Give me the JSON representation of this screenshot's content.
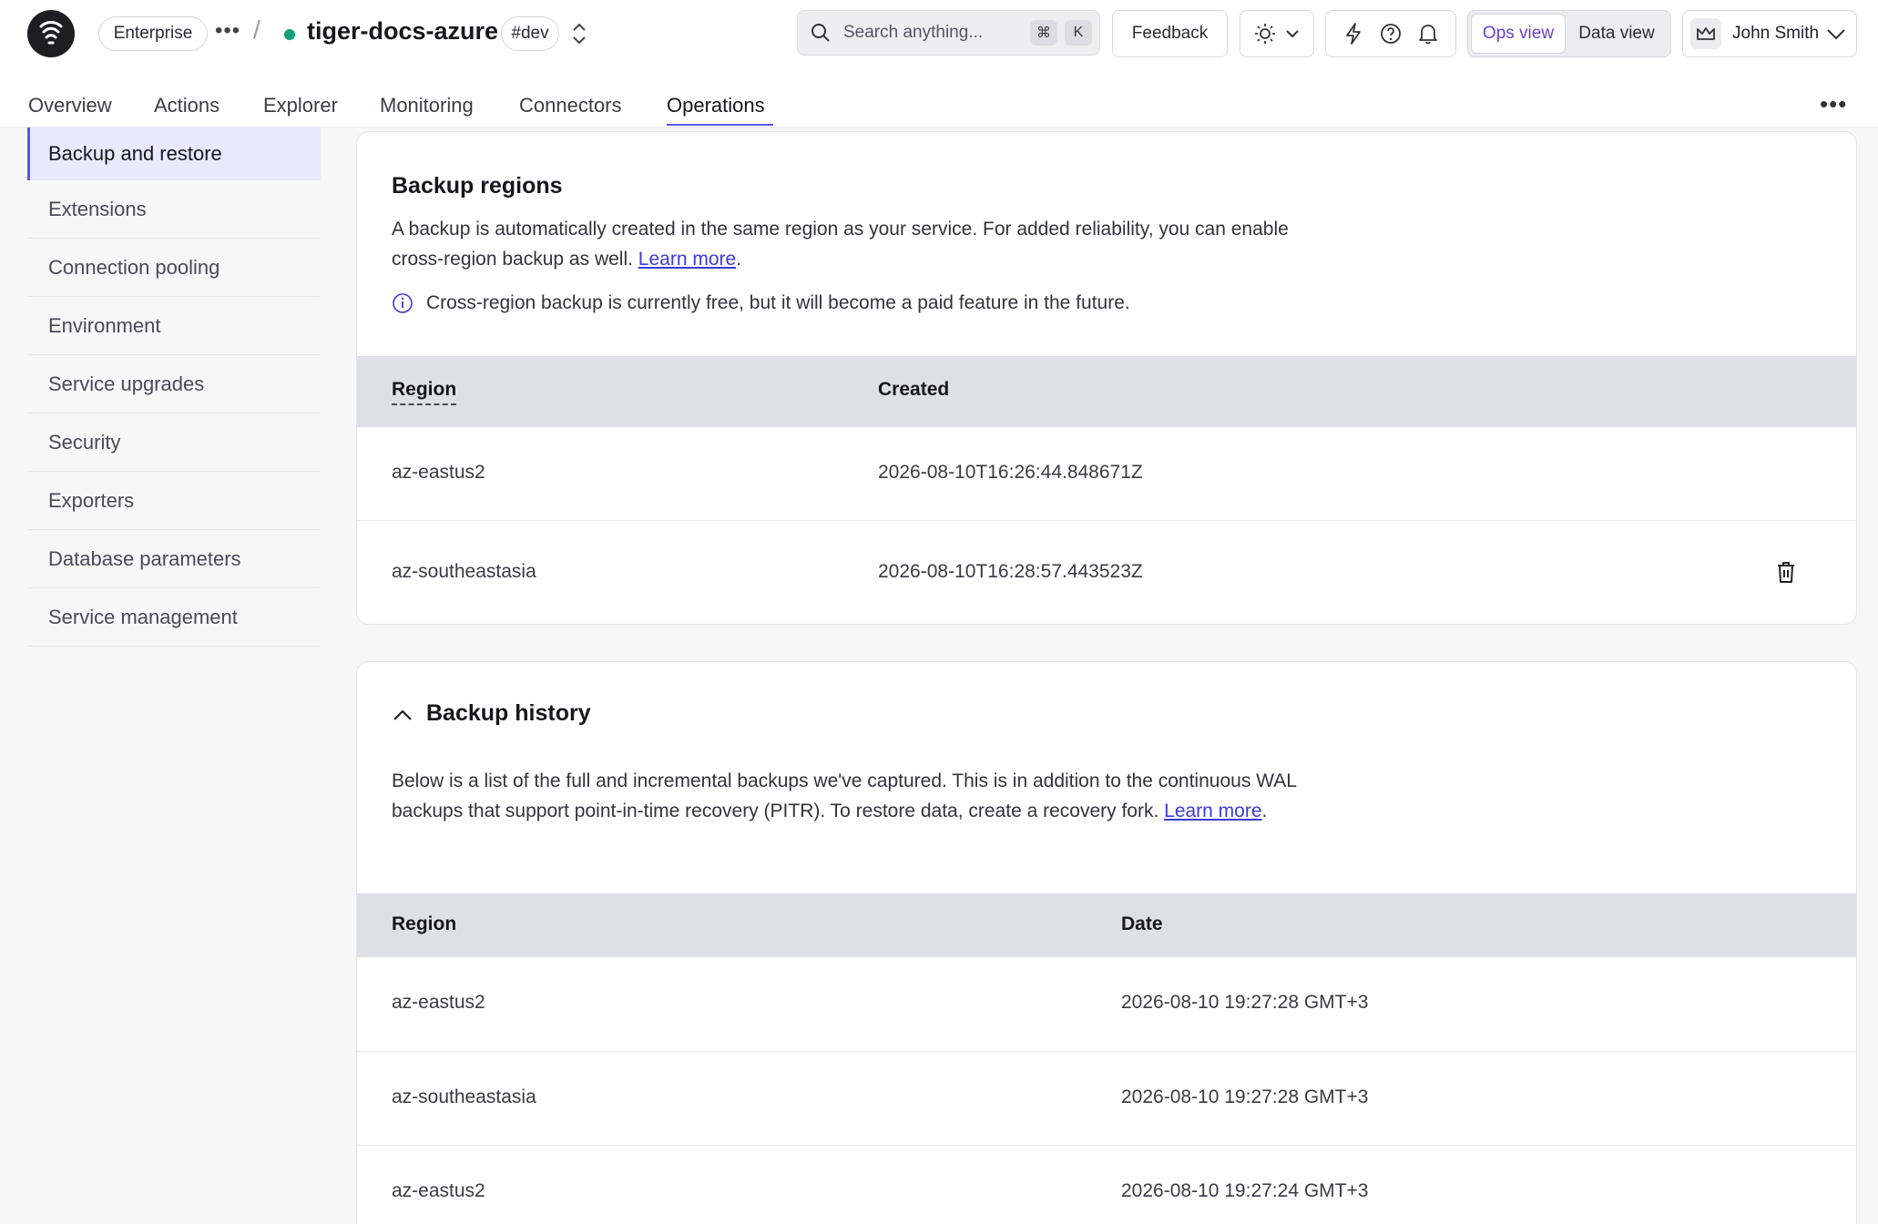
{
  "header": {
    "org_badge": "Enterprise",
    "service_name": "tiger-docs-azure",
    "env_badge": "#dev",
    "search_placeholder": "Search anything...",
    "search_shortcut_mod": "⌘",
    "search_shortcut_key": "K",
    "feedback_label": "Feedback",
    "ops_view_label": "Ops view",
    "data_view_label": "Data view",
    "user_name": "John Smith",
    "status_color": "#13a07a",
    "accent_color": "#5b56e6"
  },
  "tabs": [
    {
      "label": "Overview"
    },
    {
      "label": "Actions"
    },
    {
      "label": "Explorer"
    },
    {
      "label": "Monitoring"
    },
    {
      "label": "Connectors"
    },
    {
      "label": "Operations"
    }
  ],
  "active_tab": "Operations",
  "sidebar": {
    "items": [
      {
        "label": "Backup and restore"
      },
      {
        "label": "Extensions"
      },
      {
        "label": "Connection pooling"
      },
      {
        "label": "Environment"
      },
      {
        "label": "Service upgrades"
      },
      {
        "label": "Security"
      },
      {
        "label": "Exporters"
      },
      {
        "label": "Database parameters"
      },
      {
        "label": "Service management"
      }
    ],
    "active": "Backup and restore"
  },
  "backup_regions": {
    "title": "Backup regions",
    "desc_before_link": "A backup is automatically created in the same region as your service. For added reliability, you can enable cross-region backup as well. ",
    "link": "Learn more",
    "desc_after_link": ".",
    "info": "Cross-region backup is currently free, but it will become a paid feature in the future.",
    "columns": [
      "Region",
      "Created"
    ],
    "rows": [
      {
        "region": "az-eastus2",
        "created": "2026-08-10T16:26:44.848671Z"
      },
      {
        "region": "az-southeastasia",
        "created": "2026-08-10T16:28:57.443523Z"
      }
    ]
  },
  "backup_history": {
    "title": "Backup history",
    "desc_before_link": "Below is a list of the full and incremental backups we've captured. This is in addition to the continuous WAL backups that support point-in-time recovery (PITR). To restore data, create a recovery fork. ",
    "link": "Learn more",
    "desc_after_link": ".",
    "columns": [
      "Region",
      "Date"
    ],
    "rows": [
      {
        "region": "az-eastus2",
        "date": "2026-08-10 19:27:28 GMT+3"
      },
      {
        "region": "az-southeastasia",
        "date": "2026-08-10 19:27:28 GMT+3"
      },
      {
        "region": "az-eastus2",
        "date": "2026-08-10 19:27:24 GMT+3"
      }
    ]
  }
}
